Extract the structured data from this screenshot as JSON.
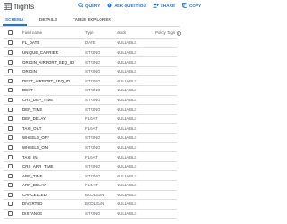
{
  "header": {
    "title": "flights",
    "actions": [
      {
        "label": "QUERY",
        "icon": "search-icon"
      },
      {
        "label": "ASK QUESTION",
        "icon": "ask-question-icon"
      },
      {
        "label": "SHARE",
        "icon": "share-icon"
      },
      {
        "label": "COPY",
        "icon": "copy-icon"
      }
    ]
  },
  "tabs": [
    {
      "label": "SCHEMA",
      "active": true
    },
    {
      "label": "DETAILS",
      "active": false
    },
    {
      "label": "TABLE EXPLORER",
      "active": false
    }
  ],
  "schema": {
    "columns": {
      "name": "Field name",
      "type": "Type",
      "mode": "Mode",
      "tags": "Policy Tags"
    },
    "rows": [
      {
        "name": "FL_DATE",
        "type": "DATE",
        "mode": "NULLABLE"
      },
      {
        "name": "UNIQUE_CARRIER",
        "type": "STRING",
        "mode": "NULLABLE"
      },
      {
        "name": "ORIGIN_AIRPORT_SEQ_ID",
        "type": "STRING",
        "mode": "NULLABLE"
      },
      {
        "name": "ORIGIN",
        "type": "STRING",
        "mode": "NULLABLE"
      },
      {
        "name": "DEST_AIRPORT_SEQ_ID",
        "type": "STRING",
        "mode": "NULLABLE"
      },
      {
        "name": "DEST",
        "type": "STRING",
        "mode": "NULLABLE"
      },
      {
        "name": "CRS_DEP_TIME",
        "type": "STRING",
        "mode": "NULLABLE"
      },
      {
        "name": "DEP_TIME",
        "type": "STRING",
        "mode": "NULLABLE"
      },
      {
        "name": "DEP_DELAY",
        "type": "FLOAT",
        "mode": "NULLABLE"
      },
      {
        "name": "TAXI_OUT",
        "type": "FLOAT",
        "mode": "NULLABLE"
      },
      {
        "name": "WHEELS_OFF",
        "type": "STRING",
        "mode": "NULLABLE"
      },
      {
        "name": "WHEELS_ON",
        "type": "STRING",
        "mode": "NULLABLE"
      },
      {
        "name": "TAXI_IN",
        "type": "FLOAT",
        "mode": "NULLABLE"
      },
      {
        "name": "CRS_ARR_TIME",
        "type": "STRING",
        "mode": "NULLABLE"
      },
      {
        "name": "ARR_TIME",
        "type": "STRING",
        "mode": "NULLABLE"
      },
      {
        "name": "ARR_DELAY",
        "type": "FLOAT",
        "mode": "NULLABLE"
      },
      {
        "name": "CANCELLED",
        "type": "BOOLEAN",
        "mode": "NULLABLE"
      },
      {
        "name": "DIVERTED",
        "type": "BOOLEAN",
        "mode": "NULLABLE"
      },
      {
        "name": "DISTANCE",
        "type": "STRING",
        "mode": "NULLABLE"
      }
    ]
  },
  "colors": {
    "accent": "#1a73e8",
    "text": "#202124",
    "muted": "#5f6368",
    "border": "#e0e0e0"
  }
}
